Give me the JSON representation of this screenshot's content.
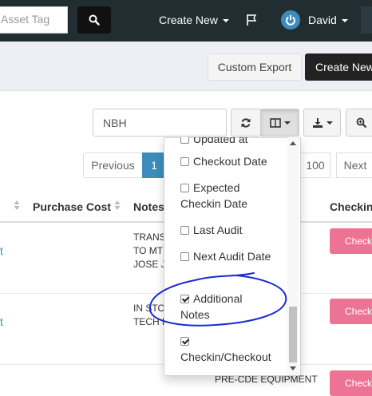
{
  "navbar": {
    "asset_tag_placeholder": "Asset Tag",
    "create_new": "Create New",
    "user_name": "David"
  },
  "header": {
    "custom_export": "Custom Export",
    "create_new": "Create New"
  },
  "toolbar": {
    "search_value": "NBH"
  },
  "pagination": {
    "previous": "Previous",
    "current_page": "1",
    "page_size": "100",
    "next": "Next"
  },
  "table": {
    "headers": {
      "purchase_cost": "Purchase Cost",
      "notes": "Notes",
      "checkin": "Checkin/"
    },
    "rows": [
      {
        "lead": "t",
        "notes": [
          "TRANS",
          "TO MT",
          "JOSE JI"
        ],
        "action": "Checko"
      },
      {
        "lead": "t",
        "notes": [
          "IN STO",
          "TECH F"
        ],
        "action": "Checko"
      },
      {
        "lead": "",
        "notes": [
          "PRE-CDE EQUIPMENT"
        ],
        "action": "Checko"
      }
    ]
  },
  "column_menu": {
    "items": [
      {
        "label": "Updated at",
        "checked": false
      },
      {
        "label": "Checkout Date",
        "checked": false
      },
      {
        "label": "Expected Checkin Date",
        "checked": false
      },
      {
        "label": "Last Audit",
        "checked": false
      },
      {
        "label": "Next Audit Date",
        "checked": false
      },
      {
        "label": "Additional Notes",
        "checked": true
      },
      {
        "label": "Checkin/Checkout",
        "checked": true
      }
    ]
  },
  "colors": {
    "navbar": "#222d32",
    "band": "#ecf0f5",
    "primary": "#3c8dbc",
    "checkin_button": "#ec7393",
    "annotation": "#1a2bd6"
  }
}
